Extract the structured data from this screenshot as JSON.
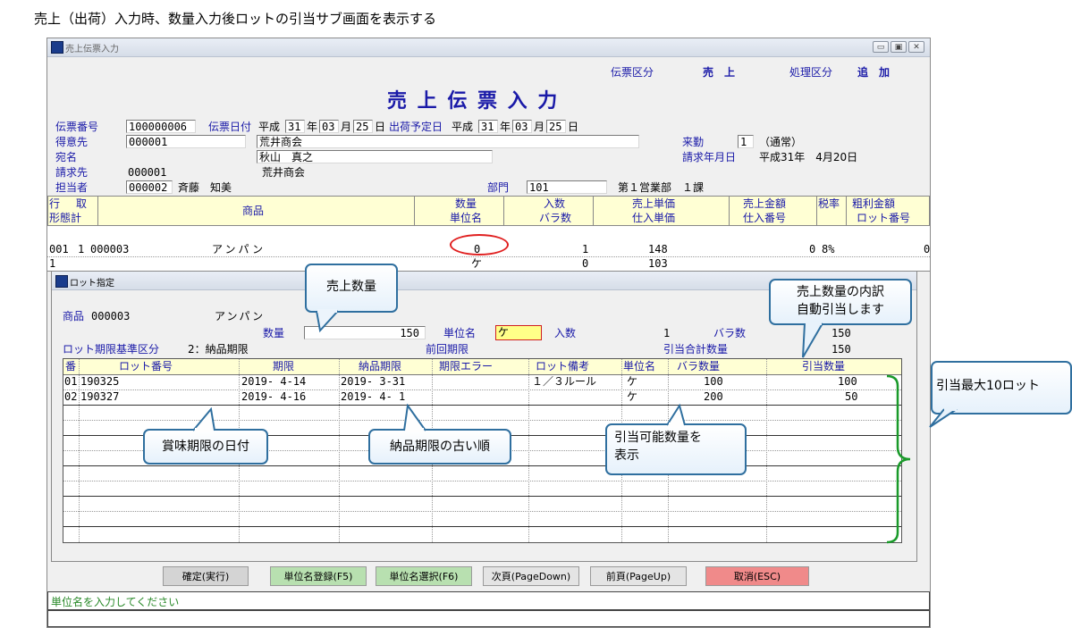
{
  "caption": "売上（出荷）入力時、数量入力後ロットの引当サブ画面を表示する",
  "window": {
    "title": "売上伝票入力",
    "form_title": "売 上 伝 票 入 力",
    "slip_type_label": "伝票区分",
    "slip_type_value": "売　上",
    "process_type_label": "処理区分",
    "process_type_value": "追　加",
    "min_btn": "▭",
    "max_btn": "▣",
    "close_btn": "✕"
  },
  "header": {
    "slip_no_label": "伝票番号",
    "slip_no": "100000006",
    "slip_date_label": "伝票日付",
    "era1": "平成",
    "slip_year": "31",
    "year_suffix": "年",
    "slip_month": "03",
    "month_suffix": "月",
    "slip_day": "25",
    "day_suffix": "日",
    "ship_date_label": "出荷予定日",
    "era2": "平成",
    "ship_year": "31",
    "ship_month": "03",
    "ship_day": "25",
    "customer_label": "得意先",
    "customer_code": "000001",
    "customer_name": "荒井商会",
    "addressee_label": "宛名",
    "addressee": "秋山　真之",
    "billing_label": "請求先",
    "billing_code": "000001",
    "billing_name": "荒井商会",
    "staff_label": "担当者",
    "staff_code": "000002",
    "staff_name": "斉藤　知美",
    "dept_label": "部門",
    "dept_code": "101",
    "dept_name": "第１営業部　１課",
    "visit_label": "来勤",
    "visit_value": "1",
    "visit_desc": "（通常）",
    "billing_month_label": "請求年月日",
    "billing_month_value": "平成31年　4月20日"
  },
  "grid": {
    "h_row": "行",
    "h_take": "取",
    "h_type": "形態計",
    "h_item": "商品",
    "h_qty": "数量",
    "h_unit": "単位名",
    "h_inqty": "入数",
    "h_bara": "バラ数",
    "h_price": "売上単価",
    "h_cost": "仕入単価",
    "h_amount": "売上金額",
    "h_po": "仕入番号",
    "h_tax": "税率",
    "h_profit": "粗利金額",
    "h_lot": "ロット番号",
    "r1_row": "001",
    "r1_take": "1",
    "r1_code": "000003",
    "r1_name": "アンパン",
    "r1_qty": "0",
    "r1_inqty": "1",
    "r1_price": "148",
    "r1_amount": "0",
    "r1_tax": "8%",
    "r1_profit": "0",
    "r2_type": "1",
    "r2_unit": "ケ",
    "r2_bara": "0",
    "r2_cost": "103"
  },
  "lot_dialog": {
    "title": "ロット指定",
    "item_label": "商品",
    "item_code": "000003",
    "item_name": "アンパン",
    "qty_label": "数量",
    "qty_value": "150",
    "unit_label": "単位名",
    "unit_value": "ケ",
    "inqty_label": "入数",
    "inqty_value": "1",
    "bara_label": "バラ数",
    "bara_value": "150",
    "basis_label": "ロット期限基準区分",
    "basis_value": "2：納品期限",
    "prev_label": "前回期限",
    "total_label": "引当合計数量",
    "total_value": "150",
    "columns": [
      "番",
      "ロット番号",
      "期限",
      "納品期限",
      "期限エラー",
      "ロット備考",
      "単位名",
      "バラ数量",
      "引当数量"
    ],
    "rows": [
      {
        "no": "01",
        "lot": "190325",
        "expiry": "2019- 4-14",
        "deliv": "2019- 3-31",
        "err": "",
        "memo": "１／３ルール",
        "unit": "ケ",
        "bara": "100",
        "alloc": "100"
      },
      {
        "no": "02",
        "lot": "190327",
        "expiry": "2019- 4-16",
        "deliv": "2019- 4- 1",
        "err": "",
        "memo": "",
        "unit": "ケ",
        "bara": "200",
        "alloc": "50"
      }
    ]
  },
  "buttons": {
    "confirm": "確定(実行)",
    "unit_reg": "単位名登録(F5)",
    "unit_sel": "単位名選択(F6)",
    "next": "次頁(PageDown)",
    "prev": "前頁(PageUp)",
    "cancel": "取消(ESC)"
  },
  "status_message": "単位名を入力してください",
  "callouts": {
    "sales_qty": "売上数量",
    "breakdown": "売上数量の内訳\n自動引当します",
    "max_lots": "引当最大10ロット",
    "expiry_date": "賞味期限の日付",
    "delivery_order": "納品期限の古い順",
    "available_qty": "引当可能数量を\n表示"
  },
  "colors": {
    "label_blue": "#1a1aa8",
    "grid_header": "#ffffd4",
    "confirm_btn": "#d4d4d4",
    "f5_btn": "#b8e0b0",
    "cancel_btn": "#f08a8a",
    "callout_border": "#2f6f9f",
    "brace_green": "#1a9a2a",
    "highlight_red": "#e02020"
  }
}
